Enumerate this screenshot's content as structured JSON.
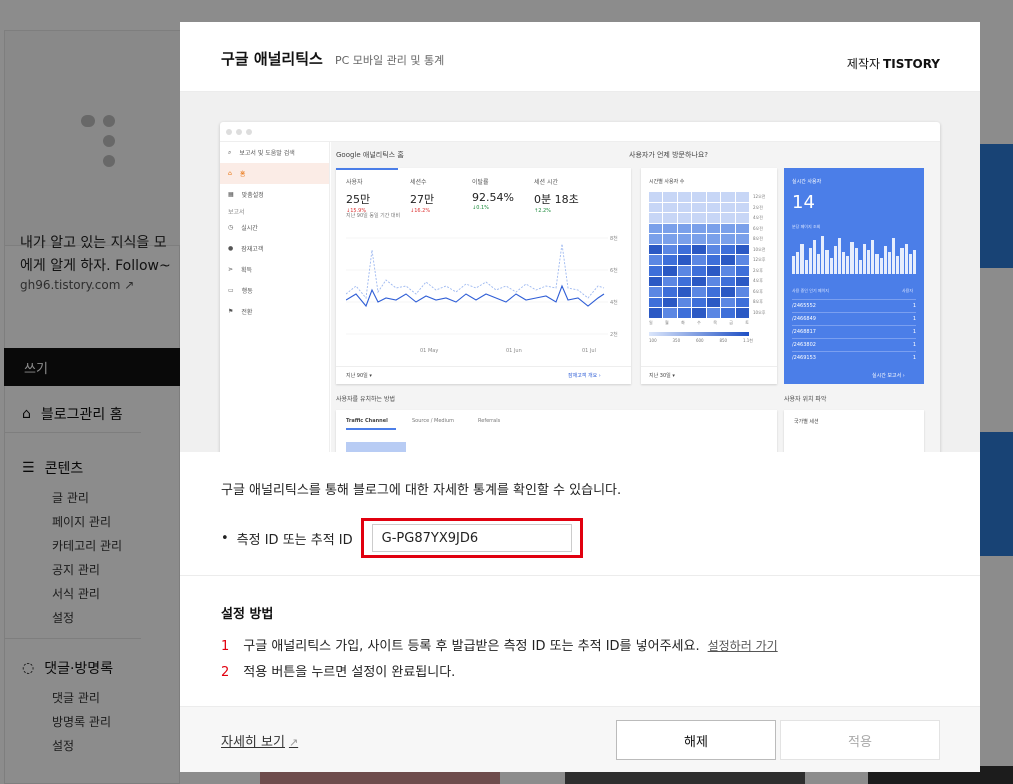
{
  "background": {
    "blog_desc_line1": "내가 알고 있는 지식을 모",
    "blog_desc_line2": "에게 알게 하자. Follow~",
    "blog_url": "gh96.tistory.com",
    "write_label": "쓰기",
    "menu": {
      "home": "블로그관리 홈",
      "contents": "콘텐츠",
      "contents_items": [
        "글 관리",
        "페이지 관리",
        "카테고리 관리",
        "공지 관리",
        "서식 관리",
        "설정"
      ],
      "comments": "댓글·방명록",
      "comments_items": [
        "댓글 관리",
        "방명록 관리",
        "설정"
      ]
    }
  },
  "modal": {
    "title": "구글 애널리틱스",
    "subtitle": "PC 모바일 관리 및 통계",
    "maker_label": "제작자",
    "maker_name": "TISTORY",
    "description": "구글 애널리틱스를 통해 블로그에 대한 자세한 통계를 확인할 수 있습니다.",
    "field_label": "측정 ID 또는 추적 ID",
    "field_value": "G-PG87YX9JD6",
    "howto_title": "설정 방법",
    "steps": [
      {
        "num": "1",
        "text": "구글 애널리틱스 가입, 사이트 등록 후 발급받은 측정 ID 또는 추적 ID를 넣어주세요.",
        "link": "설정하러 가기"
      },
      {
        "num": "2",
        "text": "적용 버튼을 누르면 설정이 완료됩니다."
      }
    ],
    "more_label": "자세히 보기",
    "off_button": "해제",
    "apply_button": "적용"
  },
  "preview": {
    "search": "보고서 및 도움말 검색",
    "nav": [
      "홈",
      "맞춤설정",
      "보고서",
      "실시간",
      "잠재고객",
      "획득",
      "행동",
      "전환"
    ],
    "home_title": "Google 애널리틱스 홈",
    "visit_title": "사용자가 언제 방문하나요?",
    "kpis": [
      {
        "label": "사용자",
        "value": "25만",
        "delta": "↓15.9%"
      },
      {
        "label": "세션수",
        "value": "27만",
        "delta": "↓16.2%"
      },
      {
        "label": "이탈률",
        "value": "92.54%",
        "delta": "↓0.1%"
      },
      {
        "label": "세션 시간",
        "value": "0분 18초",
        "delta": "↑2.2%"
      }
    ],
    "kpi_note": "지난 90일 동일 기간 대비",
    "x_labels": [
      "01 May",
      "01 Jun",
      "01 Jul"
    ],
    "y_labels": [
      "8천",
      "6천",
      "4천",
      "2천",
      "0"
    ],
    "period_label": "지난 90일 ▾",
    "audience_link": "잠재고객 개요",
    "heat_title": "시간별 사용자 수",
    "hours": [
      "12오전",
      "2오전",
      "4오전",
      "6오전",
      "8오전",
      "10오전",
      "12오후",
      "2오후",
      "4오후",
      "6오후",
      "8오후",
      "10오후"
    ],
    "days": [
      "일",
      "월",
      "화",
      "수",
      "목",
      "금",
      "토"
    ],
    "heat_scale": [
      "100",
      "350",
      "600",
      "850",
      "1.1천"
    ],
    "heat_period": "지난 30일 ▾",
    "live_title": "실시간 사용자",
    "live_value": "14",
    "live_sub": "분당 페이지 조회",
    "live_col1": "사용 중인 인기 페이지",
    "live_col2": "사용자",
    "live_rows": [
      {
        "page": "/2465552",
        "n": "1"
      },
      {
        "page": "/2466849",
        "n": "1"
      },
      {
        "page": "/2468817",
        "n": "1"
      },
      {
        "page": "/2463802",
        "n": "1"
      },
      {
        "page": "/2469153",
        "n": "1"
      }
    ],
    "live_link": "실시간 보고서",
    "traffic_title": "사용자를 유치하는 방법",
    "traffic_tabs": [
      "Traffic Channel",
      "Source / Medium",
      "Referrals"
    ],
    "location_title": "사용자 위치 파악",
    "country_label": "국가별 세션"
  }
}
